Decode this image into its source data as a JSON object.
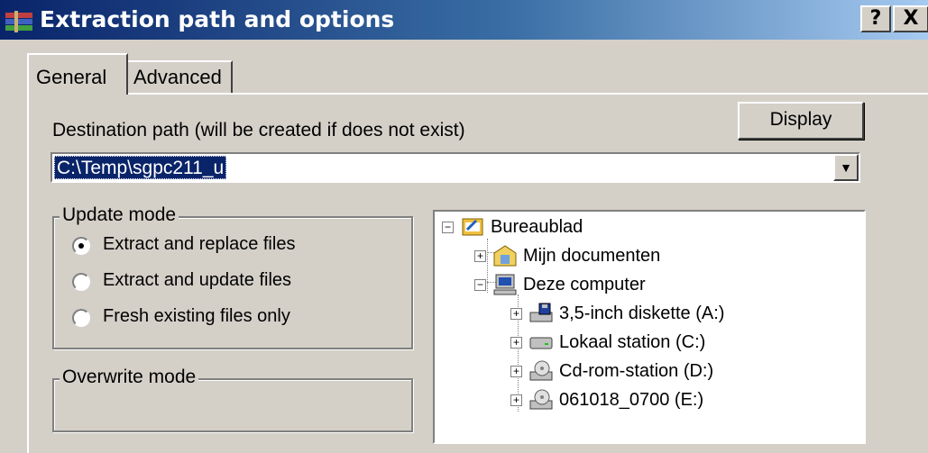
{
  "window": {
    "title": "Extraction path and options",
    "help_button": "?",
    "close_button": "X"
  },
  "tabs": [
    {
      "label": "General",
      "active": true
    },
    {
      "label": "Advanced",
      "active": false
    }
  ],
  "destination": {
    "label": "Destination path (will be created if does not exist)",
    "value": "C:\\Temp\\sgpc211_u",
    "display_button": "Display"
  },
  "update_mode": {
    "legend": "Update mode",
    "options": [
      {
        "label": "Extract and replace files",
        "selected": true
      },
      {
        "label": "Extract and update files",
        "selected": false
      },
      {
        "label": "Fresh existing files only",
        "selected": false
      }
    ]
  },
  "overwrite_mode": {
    "legend": "Overwrite mode"
  },
  "folder_tree": {
    "nodes": [
      {
        "label": "Bureaublad",
        "icon": "desktop-icon",
        "expander": "−"
      },
      {
        "label": "Mijn documenten",
        "icon": "my-documents-icon",
        "expander": "+"
      },
      {
        "label": "Deze computer",
        "icon": "computer-icon",
        "expander": "−"
      },
      {
        "label": "3,5-inch diskette (A:)",
        "icon": "floppy-icon",
        "expander": "+"
      },
      {
        "label": "Lokaal station (C:)",
        "icon": "hard-drive-icon",
        "expander": "+"
      },
      {
        "label": "Cd-rom-station (D:)",
        "icon": "cdrom-icon",
        "expander": "+"
      },
      {
        "label": "061018_0700 (E:)",
        "icon": "cdrom-icon",
        "expander": "+"
      }
    ]
  },
  "colors": {
    "title_gradient_start": "#0a246a",
    "title_gradient_end": "#a6caf0",
    "face": "#d4d0c8",
    "selection": "#0a246a"
  }
}
